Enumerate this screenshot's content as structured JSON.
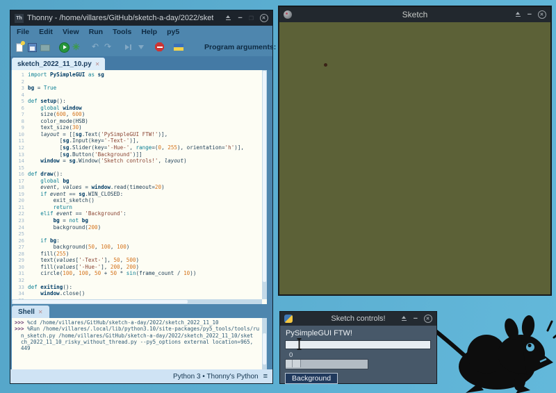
{
  "colors": {
    "desktop": "#5cafd2",
    "canvas": "#5c6137",
    "thonny_chrome": "#4e86ae",
    "titlebar_dark": "#1c232b",
    "run_green": "#27953c",
    "stop_red": "#cb3434",
    "editor_bg": "#fdfdf4",
    "controls_bg": "#475869",
    "button_bg": "#20395c"
  },
  "thonny": {
    "icon_text": "Th",
    "title": "Thonny - /home/villares/GitHub/sketch-a-day/2022/sket",
    "menus": [
      "File",
      "Edit",
      "View",
      "Run",
      "Tools",
      "Help",
      "py5"
    ],
    "toolbar": {
      "icons": [
        "new-file",
        "save",
        "open-folder",
        "run",
        "debug",
        "undo",
        "redo",
        "step-over",
        "step-into",
        "stop",
        "ukraine-flag"
      ],
      "program_arguments_label": "Program arguments:",
      "arguments_value": ""
    },
    "editor": {
      "tab": "sketch_2022_11_10.py",
      "code_lines": [
        "import PySimpleGUI as sg",
        "",
        "bg = True",
        "",
        "def setup():",
        "    global window",
        "    size(600, 600)",
        "    color_mode(HSB)",
        "    text_size(30)",
        "    layout = [[sg.Text('PySimpleGUI FTW!')],",
        "          [sg.Input(key='-Text-')],",
        "          [sg.Slider(key='-Hue-', range=(0, 255), orientation='h')],",
        "          [sg.Button('Background')]]",
        "    window = sg.Window('Sketch controls!', layout)",
        "",
        "def draw():",
        "    global bg",
        "    event, values = window.read(timeout=20)",
        "    if event == sg.WIN_CLOSED:",
        "        exit_sketch()",
        "        return",
        "    elif event == 'Background':",
        "        bg = not bg",
        "        background(200)",
        "",
        "    if bg:",
        "        background(50, 100, 100)",
        "    fill(255)",
        "    text(values['-Text-'], 50, 500)",
        "    fill(values['-Hue-'], 200, 200)",
        "    circle(100, 100, 50 + 50 * sin(frame_count / 10))",
        "",
        "def exiting():",
        "    window.close()",
        ""
      ]
    },
    "shell": {
      "tab": "Shell",
      "lines": [
        {
          "prompt": ">>> ",
          "text": "%cd /home/villares/GitHub/sketch-a-day/2022/sketch_2022_11_10"
        },
        {
          "prompt": ">>> ",
          "text": "%Run /home/villares/.local/lib/python3.10/site-packages/py5_tools/tools/ru"
        },
        {
          "prompt": "",
          "text": "n_sketch.py /home/villares/GitHub/sketch-a-day/2022/sketch_2022_11_10/sket"
        },
        {
          "prompt": "",
          "text": "ch_2022_11_10_risky_without_thread.py --py5_options external location=965,"
        },
        {
          "prompt": "",
          "text": "449"
        }
      ]
    },
    "statusbar": {
      "interpreter": "Python 3 • Thonny's Python"
    }
  },
  "sketch_window": {
    "title": "Sketch"
  },
  "controls_window": {
    "title": "Sketch controls!",
    "label": "PySimpleGUI FTW!",
    "input_value": "",
    "slider_value": "0",
    "button_label": "Background"
  }
}
